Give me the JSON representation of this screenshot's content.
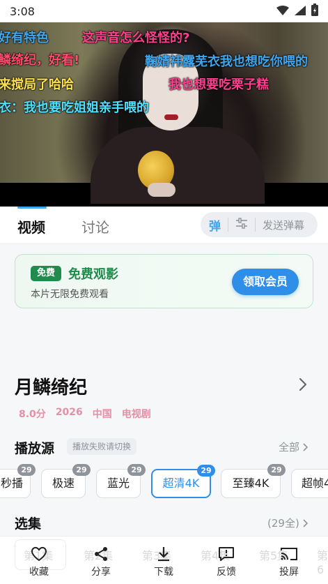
{
  "status_bar": {
    "time": "3:08"
  },
  "player": {
    "danmaku": [
      {
        "text": "好有特色",
        "color": "#3fa7f0"
      },
      {
        "text": "这声音怎么怪怪的?",
        "color": "#ff3f8e"
      },
      {
        "text": "鳞绮纪，好看!",
        "color": "#ff4d6d"
      },
      {
        "text": "鞠婧祎露芜衣我也想吃你喂的",
        "color": "#3fa7f0"
      },
      {
        "text": "来搅局了哈哈",
        "color": "#ffe24a"
      },
      {
        "text": "我也想要吃栗子糕",
        "color": "#ff3f8e"
      },
      {
        "text": "衣：我也要吃姐姐亲手喂的",
        "color": "#4ee0ff"
      }
    ]
  },
  "tabs": {
    "video": "视频",
    "discussion": "讨论"
  },
  "danmu_bar": {
    "toggle": "弹",
    "placeholder": "发送弹幕"
  },
  "vip": {
    "tag": "免费",
    "title": "免费观影",
    "subtitle": "本片无限免费观看",
    "button": "领取会员"
  },
  "show": {
    "title": "月鳞绮纪",
    "meta": [
      "8.0分",
      "2026",
      "中国",
      "电视剧"
    ]
  },
  "source": {
    "title": "播放源",
    "hint": "播放失败请切换",
    "all": "全部",
    "chips": [
      {
        "label": "秒播",
        "count": "29"
      },
      {
        "label": "极速",
        "count": "29"
      },
      {
        "label": "蓝光",
        "count": "29"
      },
      {
        "label": "超清4K",
        "count": "29",
        "active": true
      },
      {
        "label": "至臻4K",
        "count": "29"
      },
      {
        "label": "超帧4",
        "count": ""
      }
    ]
  },
  "episodes": {
    "title": "选集",
    "count": "(29全)",
    "ghost": [
      "第1集",
      "第2集",
      "第3集",
      "第4集",
      "第5集",
      "第6"
    ]
  },
  "bottom_bar": {
    "favorite": "收藏",
    "share": "分享",
    "download": "下载",
    "feedback": "反馈",
    "cast": "投屏"
  }
}
